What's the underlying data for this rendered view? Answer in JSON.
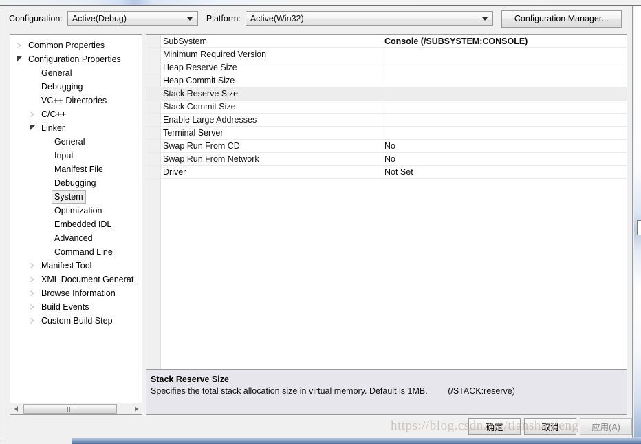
{
  "toolbar": {
    "configuration_label": "Configuration:",
    "configuration_value": "Active(Debug)",
    "platform_label": "Platform:",
    "platform_value": "Active(Win32)",
    "configuration_manager_label": "Configuration Manager..."
  },
  "tree": {
    "items": [
      {
        "label": "Common Properties",
        "indent": 0,
        "state": "collapsed",
        "selected": false
      },
      {
        "label": "Configuration Properties",
        "indent": 0,
        "state": "expanded",
        "selected": false
      },
      {
        "label": "General",
        "indent": 1,
        "state": "leaf",
        "selected": false
      },
      {
        "label": "Debugging",
        "indent": 1,
        "state": "leaf",
        "selected": false
      },
      {
        "label": "VC++ Directories",
        "indent": 1,
        "state": "leaf",
        "selected": false
      },
      {
        "label": "C/C++",
        "indent": 1,
        "state": "collapsed",
        "selected": false
      },
      {
        "label": "Linker",
        "indent": 1,
        "state": "expanded",
        "selected": false
      },
      {
        "label": "General",
        "indent": 2,
        "state": "leaf",
        "selected": false
      },
      {
        "label": "Input",
        "indent": 2,
        "state": "leaf",
        "selected": false
      },
      {
        "label": "Manifest File",
        "indent": 2,
        "state": "leaf",
        "selected": false
      },
      {
        "label": "Debugging",
        "indent": 2,
        "state": "leaf",
        "selected": false
      },
      {
        "label": "System",
        "indent": 2,
        "state": "leaf",
        "selected": true
      },
      {
        "label": "Optimization",
        "indent": 2,
        "state": "leaf",
        "selected": false
      },
      {
        "label": "Embedded IDL",
        "indent": 2,
        "state": "leaf",
        "selected": false
      },
      {
        "label": "Advanced",
        "indent": 2,
        "state": "leaf",
        "selected": false
      },
      {
        "label": "Command Line",
        "indent": 2,
        "state": "leaf",
        "selected": false
      },
      {
        "label": "Manifest Tool",
        "indent": 1,
        "state": "collapsed",
        "selected": false
      },
      {
        "label": "XML Document Generat",
        "indent": 1,
        "state": "collapsed",
        "selected": false
      },
      {
        "label": "Browse Information",
        "indent": 1,
        "state": "collapsed",
        "selected": false
      },
      {
        "label": "Build Events",
        "indent": 1,
        "state": "collapsed",
        "selected": false
      },
      {
        "label": "Custom Build Step",
        "indent": 1,
        "state": "collapsed",
        "selected": false
      }
    ],
    "scrollbar": {
      "left_arrow": "left-arrow",
      "right_arrow": "right-arrow"
    }
  },
  "property_grid": {
    "rows": [
      {
        "name": "SubSystem",
        "value": "Console (/SUBSYSTEM:CONSOLE)",
        "selected": false,
        "bold": true
      },
      {
        "name": "Minimum Required Version",
        "value": "",
        "selected": false,
        "bold": false
      },
      {
        "name": "Heap Reserve Size",
        "value": "",
        "selected": false,
        "bold": false
      },
      {
        "name": "Heap Commit Size",
        "value": "",
        "selected": false,
        "bold": false
      },
      {
        "name": "Stack Reserve Size",
        "value": "",
        "selected": true,
        "bold": false
      },
      {
        "name": "Stack Commit Size",
        "value": "",
        "selected": false,
        "bold": false
      },
      {
        "name": "Enable Large Addresses",
        "value": "",
        "selected": false,
        "bold": false
      },
      {
        "name": "Terminal Server",
        "value": "",
        "selected": false,
        "bold": false
      },
      {
        "name": "Swap Run From CD",
        "value": "No",
        "selected": false,
        "bold": false
      },
      {
        "name": "Swap Run From Network",
        "value": "No",
        "selected": false,
        "bold": false
      },
      {
        "name": "Driver",
        "value": "Not Set",
        "selected": false,
        "bold": false
      }
    ]
  },
  "description": {
    "title": "Stack Reserve Size",
    "text": "Specifies the total stack allocation size in virtual memory. Default is 1MB.",
    "switch": "(/STACK:reserve)"
  },
  "footer": {
    "ok_label": "确定",
    "cancel_label": "取消",
    "apply_label": "应用(A)"
  },
  "watermark": {
    "text": "https://blog.csdn.net/tianshanfeng"
  }
}
